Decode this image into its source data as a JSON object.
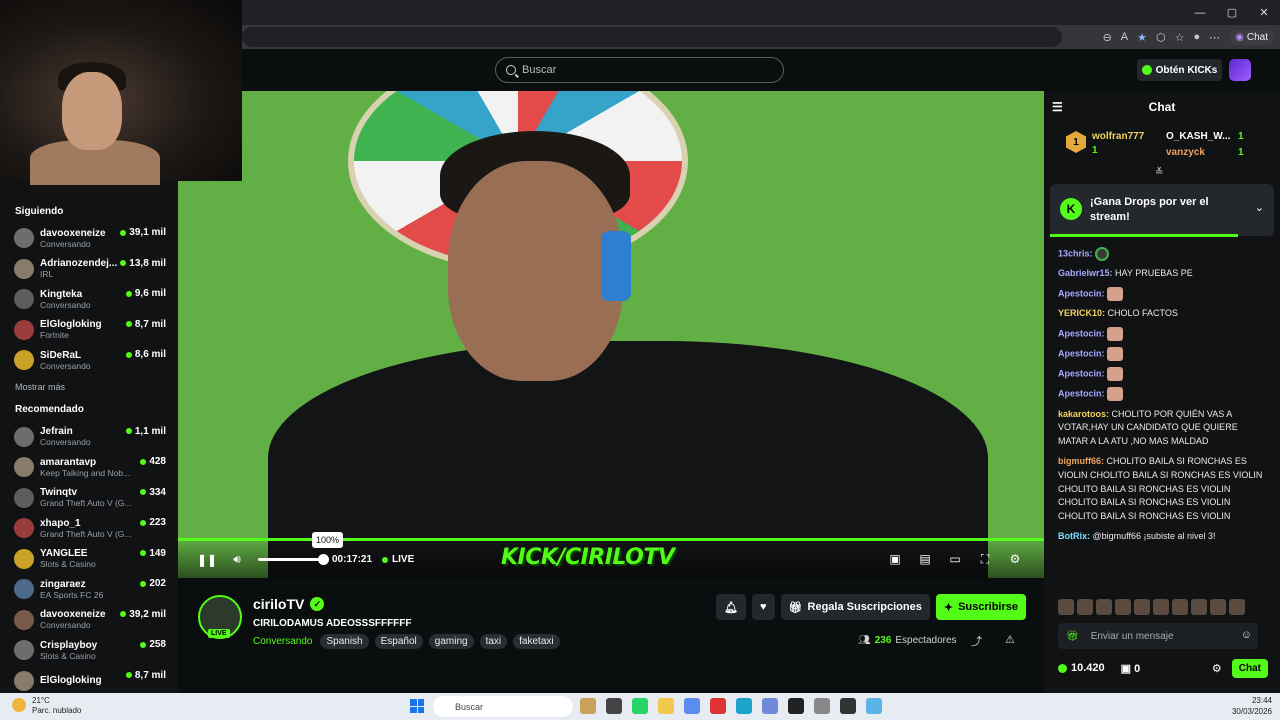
{
  "browser": {
    "chat_label": "Chat"
  },
  "header": {
    "search_placeholder": "Buscar",
    "kicks_label": "Obtén KICKs"
  },
  "sidebar": {
    "following_title": "Siguiendo",
    "following": [
      {
        "name": "davooxeneize",
        "category": "Conversando",
        "viewers": "39,1 mil"
      },
      {
        "name": "Adrianozendej...",
        "category": "IRL",
        "viewers": "13,8 mil"
      },
      {
        "name": "Kingteka",
        "category": "Conversando",
        "viewers": "9,6 mil"
      },
      {
        "name": "ElGlogloking",
        "category": "Fortnite",
        "viewers": "8,7 mil"
      },
      {
        "name": "SiDeRaL",
        "category": "Conversando",
        "viewers": "8,6 mil"
      }
    ],
    "show_more": "Mostrar más",
    "recommended_title": "Recomendado",
    "recommended": [
      {
        "name": "Jefrain",
        "category": "Conversando",
        "viewers": "1,1 mil"
      },
      {
        "name": "amarantavp",
        "category": "Keep Talking and Nob...",
        "viewers": "428"
      },
      {
        "name": "Twinqtv",
        "category": "Grand Theft Auto V (G...",
        "viewers": "334"
      },
      {
        "name": "xhapo_1",
        "category": "Grand Theft Auto V (G...",
        "viewers": "223"
      },
      {
        "name": "YANGLEE",
        "category": "Slots & Casino",
        "viewers": "149"
      },
      {
        "name": "zingaraez",
        "category": "EA Sports FC 26",
        "viewers": "202"
      },
      {
        "name": "davooxeneize",
        "category": "Conversando",
        "viewers": "39,2 mil"
      },
      {
        "name": "Crisplayboy",
        "category": "Slots & Casino",
        "viewers": "258"
      },
      {
        "name": "ElGlogloking",
        "category": "",
        "viewers": "8,7 mil"
      }
    ]
  },
  "player": {
    "volume_tooltip": "100%",
    "volume_level": 1.0,
    "time": "00:17:21",
    "live_label": "LIVE",
    "watermark": "KICK/CIRILOTV"
  },
  "channel": {
    "name": "ciriloTV",
    "live_badge": "LIVE",
    "title": "CIRILODAMUS ADEOSSSFFFFFF",
    "category": "Conversando",
    "tags": [
      "Spanish",
      "Español",
      "gaming",
      "taxi",
      "faketaxi"
    ],
    "gift_label": "Regala Suscripciones",
    "subscribe_label": "Suscribirse",
    "viewers_count": "236",
    "viewers_label": "Espectadores"
  },
  "chat": {
    "title": "Chat",
    "leaderboard": [
      {
        "name": "wolfran777",
        "value": "1"
      },
      {
        "name": "O_KASH_W...",
        "value": "1"
      },
      {
        "name": "vanzyck",
        "value": "1"
      }
    ],
    "leader_rank": "1",
    "drops_title": "¡Gana Drops por ver el stream!",
    "drops_progress": 0.84,
    "messages": [
      {
        "user": "13chris:",
        "text": "",
        "color": "#a7a9ff"
      },
      {
        "user": "Gabrielwr15:",
        "text": "HAY PRUEBAS PE",
        "color": "#a7a9ff"
      },
      {
        "user": "Apestocin:",
        "text": "",
        "color": "#a7a9ff"
      },
      {
        "user": "YERICK10:",
        "text": "CHOLO FACTOS",
        "color": "#f1d35e"
      },
      {
        "user": "Apestocin:",
        "text": "",
        "color": "#a7a9ff"
      },
      {
        "user": "Apestocin:",
        "text": "",
        "color": "#a7a9ff"
      },
      {
        "user": "Apestocin:",
        "text": "",
        "color": "#a7a9ff"
      },
      {
        "user": "Apestocin:",
        "text": "",
        "color": "#a7a9ff"
      },
      {
        "user": "kakarotoos:",
        "text": "CHOLITO POR QUIÉN VAS A VOTAR,HAY UN CANDIDATO QUE QUIERE MATAR A LA ATU ,NO MAS MALDAD",
        "color": "#f1d35e"
      },
      {
        "user": "bigmuff66:",
        "text": "CHOLITO BAILA SI RONCHAS ES VIOLIN CHOLITO BAILA SI RONCHAS ES VIOLIN CHOLITO BAILA SI RONCHAS ES VIOLIN CHOLITO BAILA SI RONCHAS ES VIOLIN CHOLITO BAILA SI RONCHAS ES VIOLIN",
        "color": "#f1a35e"
      },
      {
        "user": "BotRix:",
        "text": "@bigmuff66 ¡subiste al nivel 3!",
        "color": "#7ee0ff"
      },
      {
        "user": "13chris:",
        "text": "",
        "color": "#a7a9ff"
      }
    ],
    "input_placeholder": "Enviar un mensaje",
    "points": "10.420",
    "gifts": "0",
    "send_label": "Chat"
  },
  "taskbar": {
    "temp": "21°C",
    "weather": "Parc. nublado",
    "search": "Buscar",
    "time": "23:44",
    "date": "30/03/2026"
  },
  "colors": {
    "accent": "#53fc18",
    "bg": "#0b0e0f"
  }
}
